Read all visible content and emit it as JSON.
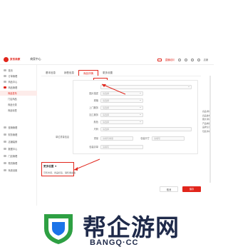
{
  "colors": {
    "brand": "#e1251b",
    "watermark": "#1f2a4a",
    "watermark_accent": "#2ea043",
    "watermark_accent_2": "#1b73e8"
  },
  "topbar": {
    "logo_text": "京东商家",
    "merchant_center": "商家中心",
    "right_items": [
      "直播培训",
      "",
      "",
      "",
      "",
      "店铺"
    ]
  },
  "sidebar": {
    "items": [
      {
        "label": "首页",
        "sub": false,
        "active": false
      },
      {
        "label": "订单管理",
        "sub": false,
        "active": false
      },
      {
        "label": "商品中心",
        "sub": false,
        "active": false
      },
      {
        "label": "商品管理",
        "sub": false,
        "active": false,
        "icon_red": true
      },
      {
        "label": "商品发布",
        "sub": true,
        "active": true
      },
      {
        "label": "门店商品",
        "sub": true,
        "active": false
      },
      {
        "label": "商品分类",
        "sub": true,
        "active": false
      },
      {
        "label": "商品标签",
        "sub": true,
        "active": false
      },
      {
        "label": "",
        "sub": true,
        "active": false
      },
      {
        "label": "营销管理",
        "sub": false,
        "active": false
      },
      {
        "label": "财务管理",
        "sub": false,
        "active": false
      },
      {
        "label": "店铺装修",
        "sub": false,
        "active": false
      },
      {
        "label": "数据中心",
        "sub": false,
        "active": false
      },
      {
        "label": "门店管理",
        "sub": false,
        "active": false
      },
      {
        "label": "物流管理",
        "sub": false,
        "active": false
      },
      {
        "label": "系统设置",
        "sub": false,
        "active": false
      }
    ]
  },
  "tabs": [
    {
      "label": "基本信息",
      "active": false
    },
    {
      "label": "销售信息",
      "active": false
    },
    {
      "label": "商品详情",
      "active": true
    },
    {
      "label": "更多设置",
      "active": false
    }
  ],
  "annotation": {
    "label": "商品详情"
  },
  "form": {
    "rows": [
      {
        "label": "",
        "value": ""
      },
      {
        "label": "图片描述",
        "value": "请选择"
      },
      {
        "label": "规格",
        "value": "请选择"
      },
      {
        "label": "上门服务",
        "value": "请选择"
      },
      {
        "label": "加工服务",
        "value": "请选择"
      },
      {
        "label": "颜色",
        "value": "请选择"
      },
      {
        "label": "尺码",
        "value": "请选择"
      }
    ],
    "middle_label": "单位重量信息",
    "weight_row": {
      "label": "重量",
      "value": "请填写重量",
      "unit_label": "包装尺寸",
      "unit_value": "请填写"
    },
    "extra_row": {
      "label": "包装清单",
      "value": "请填写"
    }
  },
  "right_links": [
    "商品详情",
    "商品发布",
    "图文详情",
    "产品参数",
    "品牌信息",
    "包装清单"
  ],
  "more_settings": {
    "title": "更多设置",
    "description": "可售时间、商品标签、销售佣金等"
  },
  "buttons": {
    "cancel": "取消",
    "save": "保存"
  },
  "watermark": {
    "text": "帮企游网",
    "url": "BANGQ·CC"
  }
}
